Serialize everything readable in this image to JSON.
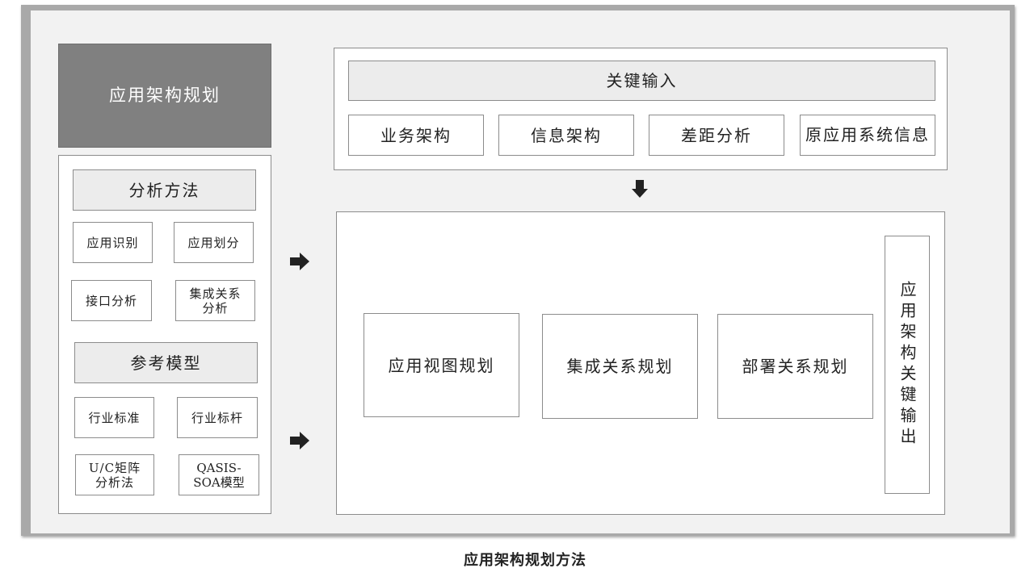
{
  "left": {
    "title": "应用架构规划",
    "analysis": {
      "heading": "分析方法",
      "items": [
        "应用识别",
        "应用划分",
        "接口分析",
        "集成关系分析"
      ]
    },
    "reference": {
      "heading": "参考模型",
      "items": [
        "行业标准",
        "行业标杆",
        "U/C矩阵分析法",
        "QASIS-SOA模型"
      ]
    }
  },
  "inputs": {
    "heading": "关键输入",
    "items": [
      "业务架构",
      "信息架构",
      "差距分析",
      "原应用系统信息"
    ]
  },
  "outputs": {
    "items": [
      "应用视图规划",
      "集成关系规划",
      "部署关系规划"
    ],
    "side_label": "应用架构关键输出"
  },
  "caption": "应用架构规划方法",
  "colors": {
    "frame": "#a9a9a9",
    "background": "#f2f2f2",
    "title_box": "#808080",
    "heading_box": "#ececec",
    "arrow": "#222222"
  }
}
